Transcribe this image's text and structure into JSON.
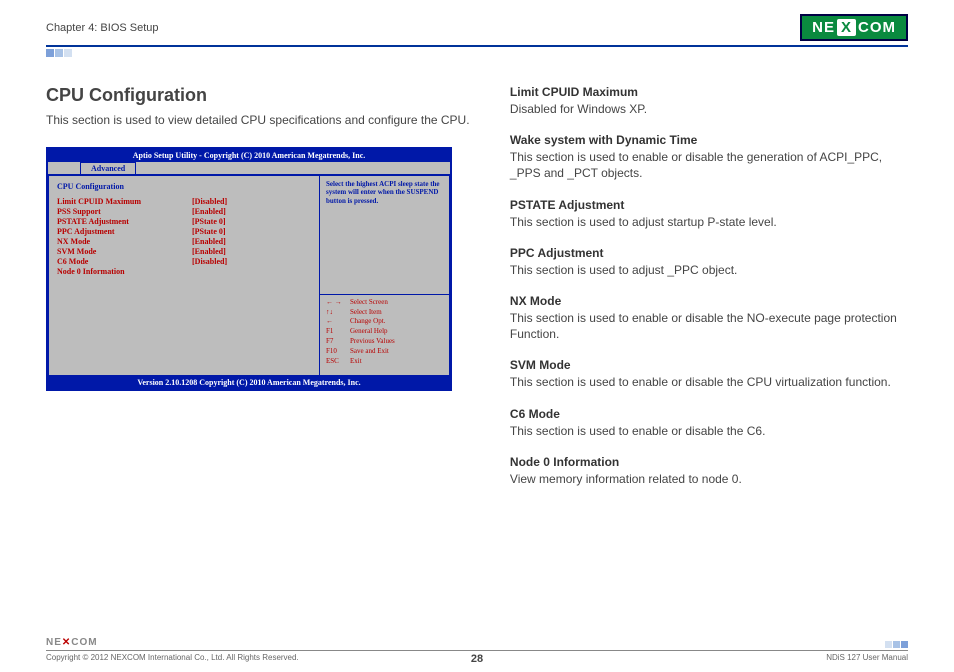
{
  "header": {
    "chapter": "Chapter 4: BIOS Setup",
    "logo_pre": "NE",
    "logo_x": "X",
    "logo_post": "COM"
  },
  "section": {
    "title": "CPU Configuration",
    "desc": "This section is used to view detailed CPU specifications and configure the CPU."
  },
  "bios": {
    "title": "Aptio  Setup  Utility - Copyright (C) 2010 American Megatrends, Inc.",
    "tab": "Advanced",
    "heading": "CPU Configuration",
    "rows": [
      {
        "label": "Limit CPUID Maximum",
        "value": "[Disabled]"
      },
      {
        "label": "PSS Support",
        "value": "[Enabled]"
      },
      {
        "label": "PSTATE Adjustment",
        "value": "[PState 0]"
      },
      {
        "label": "PPC Adjustment",
        "value": "[PState 0]"
      },
      {
        "label": "NX Mode",
        "value": "[Enabled]"
      },
      {
        "label": "SVM Mode",
        "value": "[Enabled]"
      },
      {
        "label": "C6 Mode",
        "value": "[Disabled]"
      },
      {
        "label": "Node 0 Information",
        "value": ""
      }
    ],
    "help": "Select the highest ACPI sleep state the system will enter when the SUSPEND button is pressed.",
    "keys": [
      {
        "key": "← →",
        "action": "Select Screen"
      },
      {
        "key": "↑↓",
        "action": "Select Item"
      },
      {
        "key": "←",
        "action": "Change Opt."
      },
      {
        "key": "F1",
        "action": "General Help"
      },
      {
        "key": "F7",
        "action": "Previous Values"
      },
      {
        "key": "F10",
        "action": "Save and Exit"
      },
      {
        "key": "ESC",
        "action": "Exit"
      }
    ],
    "footer": "Version 2.10.1208 Copyright (C) 2010 American Megatrends, Inc."
  },
  "options": [
    {
      "title": "Limit CPUID Maximum",
      "desc": "Disabled for Windows XP."
    },
    {
      "title": "Wake system with Dynamic Time",
      "desc": "This section is used to enable or disable the generation of ACPI_PPC, _PPS and _PCT objects."
    },
    {
      "title": "PSTATE Adjustment",
      "desc": "This section is used to adjust startup P-state level."
    },
    {
      "title": "PPC Adjustment",
      "desc": "This section is used to adjust _PPC object."
    },
    {
      "title": "NX Mode",
      "desc": "This section is used to enable or disable the NO-execute page protection Function."
    },
    {
      "title": "SVM Mode",
      "desc": "This section is used to enable or disable the CPU virtualization function."
    },
    {
      "title": "C6 Mode",
      "desc": "This section is used to enable or disable the C6."
    },
    {
      "title": "Node 0 Information",
      "desc": "View memory information related to node 0."
    }
  ],
  "footer": {
    "logo": "NE COM",
    "copyright": "Copyright © 2012 NEXCOM International Co., Ltd. All Rights Reserved.",
    "page": "28",
    "manual": "NDiS 127 User Manual"
  }
}
